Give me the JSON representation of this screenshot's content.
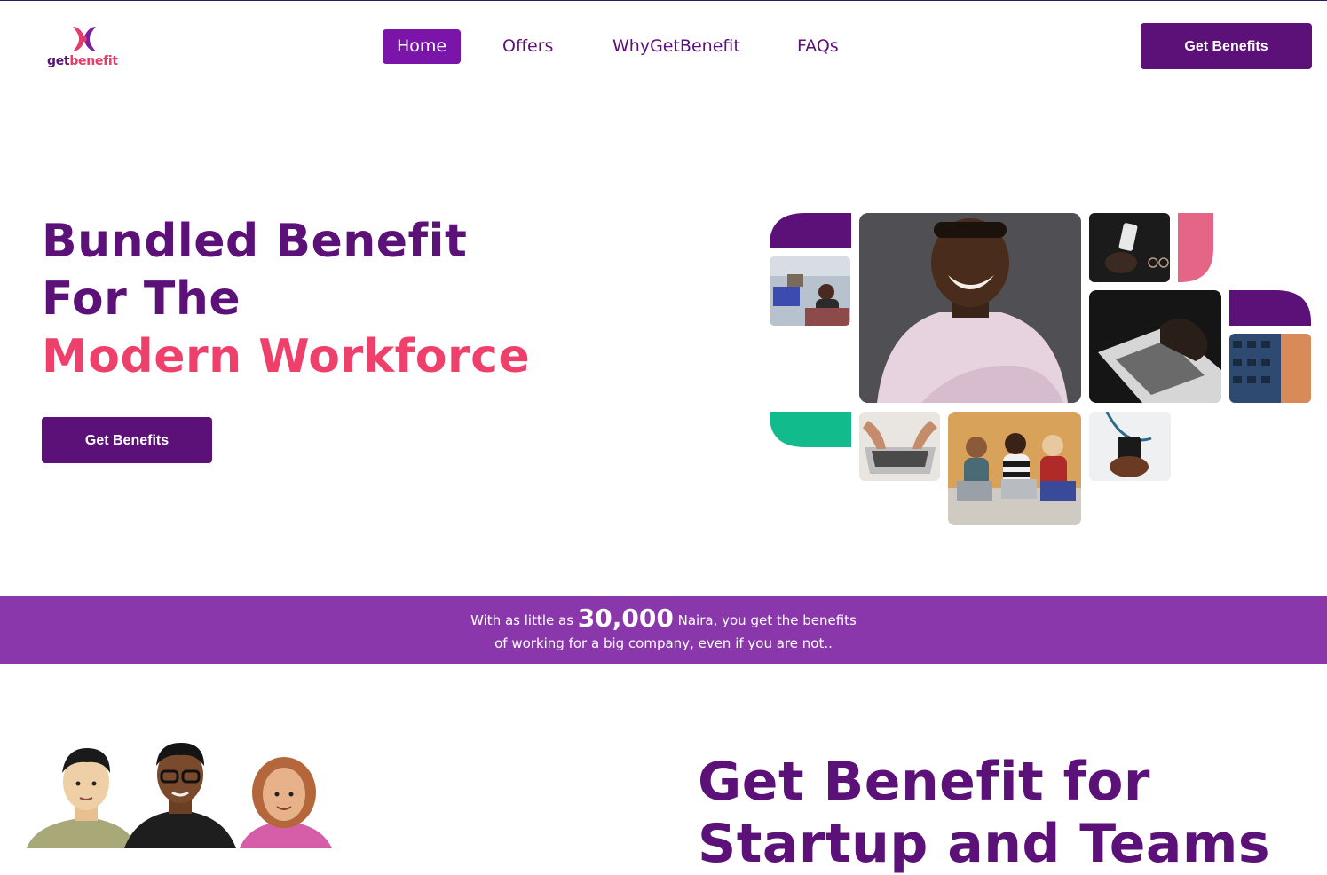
{
  "brand": {
    "name_part1": "get",
    "name_part2": "benefit"
  },
  "nav": {
    "items": [
      {
        "label": "Home",
        "active": true
      },
      {
        "label": "Offers",
        "active": false
      },
      {
        "label": "WhyGetBenefit",
        "active": false
      },
      {
        "label": "FAQs",
        "active": false
      }
    ],
    "cta_label": "Get Benefits"
  },
  "hero": {
    "line1": "Bundled Benefit",
    "line2": "For The",
    "line3": "Modern Workforce",
    "cta_label": "Get Benefits"
  },
  "banner": {
    "prefix": "With as little as",
    "amount": "30,000",
    "suffix": "Naira, you get the benefits",
    "line2": "of working for a big company, even if you are not.."
  },
  "section": {
    "title_line1": "Get Benefit for",
    "title_line2": "Startup and Teams"
  },
  "colors": {
    "primary": "#5b1178",
    "accent_pink": "#ef3f6b",
    "banner_purple": "#8a37ab",
    "nav_active": "#7b14a8",
    "shape_green": "#11bb8c",
    "shape_pink": "#e46585"
  }
}
